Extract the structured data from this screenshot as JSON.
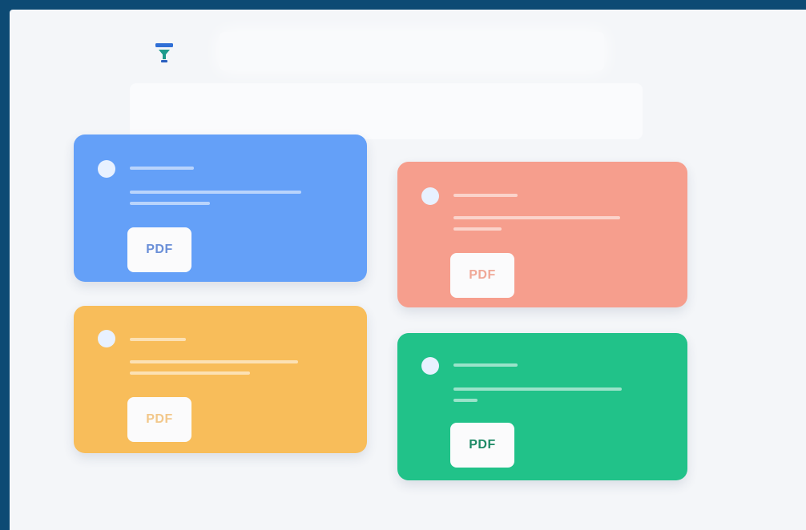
{
  "header": {
    "logo_icon": "funnel-icon",
    "accent_color": "#2266cc"
  },
  "cards": [
    {
      "color": "#64a0f8",
      "icon": "circle-dot-icon",
      "file_label": "PDF",
      "label_color": "#6a8fd8"
    },
    {
      "color": "#f69e8d",
      "icon": "circle-dot-icon",
      "file_label": "PDF",
      "label_color": "#f0a897"
    },
    {
      "color": "#f8bd5a",
      "icon": "circle-dot-icon",
      "file_label": "PDF",
      "label_color": "#f2c78a"
    },
    {
      "color": "#21c289",
      "icon": "circle-dot-icon",
      "file_label": "PDF",
      "label_color": "#1e8a66"
    }
  ]
}
